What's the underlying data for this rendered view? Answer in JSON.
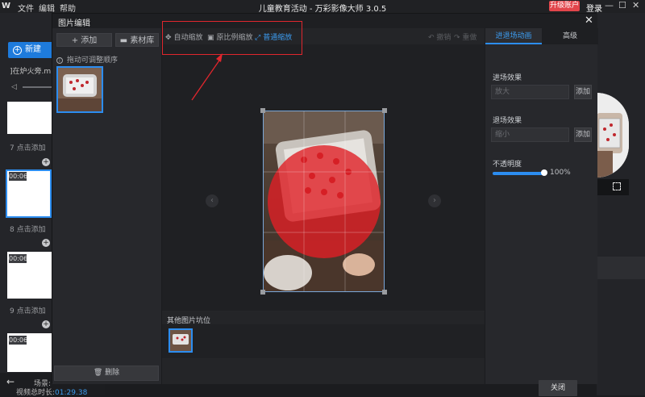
{
  "app": {
    "logo": "W",
    "menu": [
      "文件",
      "编辑",
      "帮助"
    ],
    "title": "儿童教育活动 - 万彩影像大师 3.0.5",
    "upgrade": "升级账户",
    "login": "登录",
    "new_button": "新建",
    "music_name": "]在炉火旁.m",
    "scenes": [
      {
        "number": "7",
        "label": "点击添加"
      },
      {
        "number": "8",
        "label": "点击添加",
        "duration": "00:06"
      },
      {
        "number": "9",
        "label": "点击添加",
        "duration": "00:06"
      },
      {
        "duration": "00:06"
      }
    ],
    "footer": {
      "scene_label": "场景:",
      "total_label": "视频总时长:",
      "total_time": "01:29.38"
    }
  },
  "dialog": {
    "title": "图片编辑",
    "left": {
      "add_label": "添加",
      "library_label": "素材库",
      "hint": "拖动可调整顺序",
      "delete_label": "删除"
    },
    "toolbar": {
      "items": [
        {
          "label": "自动缩放",
          "icon": "auto-zoom-icon",
          "active": false
        },
        {
          "label": "原比例缩放",
          "icon": "original-scale-icon",
          "active": false
        },
        {
          "label": "普通缩放",
          "icon": "normal-zoom-icon",
          "active": true
        }
      ],
      "undo": "撤销",
      "redo": "重做"
    },
    "others_label": "其他图片坑位",
    "right": {
      "tabs": [
        "进退场动画",
        "高级"
      ],
      "enter_label": "进场效果",
      "enter_value": "放大",
      "exit_label": "退场效果",
      "exit_value": "缩小",
      "add": "添加",
      "opacity_label": "不透明度",
      "opacity_value": "100%"
    },
    "close_button": "关闭"
  },
  "colors": {
    "accent": "#2c8df0",
    "annotation": "#e0262d",
    "upgrade": "#e2454b"
  }
}
